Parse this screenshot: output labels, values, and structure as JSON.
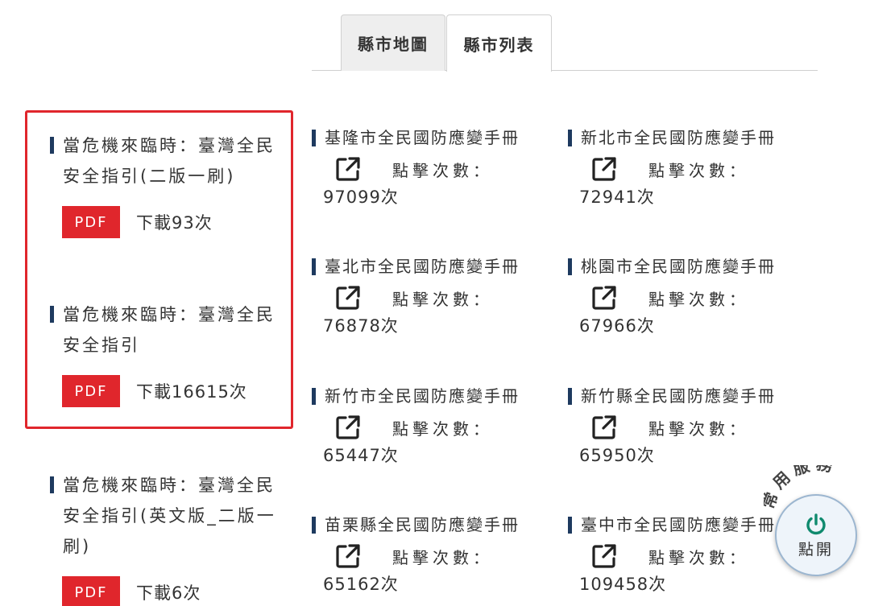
{
  "tabs": [
    {
      "label": "縣市地圖"
    },
    {
      "label": "縣市列表"
    }
  ],
  "guides": [
    {
      "title": "當危機來臨時：臺灣全民安全指引(二版一刷)",
      "pdf_label": "PDF",
      "downloads": "下載93次"
    },
    {
      "title": "當危機來臨時：臺灣全民安全指引",
      "pdf_label": "PDF",
      "downloads": "下載16615次"
    },
    {
      "title": "當危機來臨時：臺灣全民安全指引(英文版_二版一刷)",
      "pdf_label": "PDF",
      "downloads": "下載6次"
    }
  ],
  "cities": [
    {
      "title": "基隆市全民國防應變手冊",
      "click_label": "點擊次數：",
      "count": "97099次"
    },
    {
      "title": "新北市全民國防應變手冊",
      "click_label": "點擊次數：",
      "count": "72941次"
    },
    {
      "title": "臺北市全民國防應變手冊",
      "click_label": "點擊次數：",
      "count": "76878次"
    },
    {
      "title": "桃園市全民國防應變手冊",
      "click_label": "點擊次數：",
      "count": "67966次"
    },
    {
      "title": "新竹市全民國防應變手冊",
      "click_label": "點擊次數：",
      "count": "65447次"
    },
    {
      "title": "新竹縣全民國防應變手冊",
      "click_label": "點擊次數：",
      "count": "65950次"
    },
    {
      "title": "苗栗縣全民國防應變手冊",
      "click_label": "點擊次數：",
      "count": "65162次"
    },
    {
      "title": "臺中市全民國防應變手冊",
      "click_label": "點擊次數：",
      "count": "109458次"
    }
  ],
  "service": {
    "arc_label": "常用服務",
    "button_label": "點開",
    "icon": "power-icon"
  },
  "colors": {
    "accent_red": "#e0262c",
    "marker_navy": "#1e3a5f",
    "power_green": "#0f8a6e"
  }
}
